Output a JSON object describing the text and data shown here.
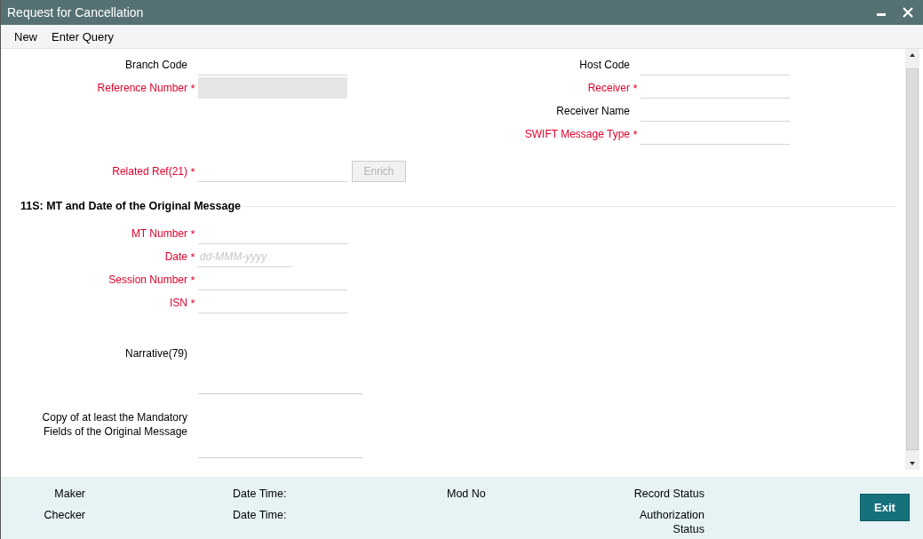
{
  "window": {
    "title": "Request for Cancellation"
  },
  "toolbar": [
    {
      "label": "New"
    },
    {
      "label": "Enter Query"
    }
  ],
  "header_left": [
    {
      "label": "Branch Code",
      "disabled": false
    },
    {
      "label": "Reference Number",
      "required_mark": "*",
      "disabled": true
    }
  ],
  "header_right": [
    {
      "label": "Host Code"
    },
    {
      "label": "Receiver",
      "required_mark": "*"
    },
    {
      "label": "Receiver Name"
    },
    {
      "label": "SWIFT Message Type",
      "required_mark": "*"
    }
  ],
  "related_ref": {
    "label": "Related Ref(21)",
    "required_mark": "*"
  },
  "enrich_button": {
    "label": "Enrich",
    "disabled": true
  },
  "section": {
    "title": "11S: MT and Date of the Original Message"
  },
  "message_fields": [
    {
      "label": "MT Number",
      "required_mark": "*",
      "kind": "text"
    },
    {
      "label": "Date",
      "required_mark": "*",
      "kind": "date",
      "placeholder": "dd-MMM-yyyy"
    },
    {
      "label": "Session Number",
      "required_mark": "*",
      "kind": "text"
    },
    {
      "label": "ISN",
      "required_mark": "*",
      "kind": "text"
    }
  ],
  "text_areas": [
    {
      "label": "Narrative(79)"
    },
    {
      "label": "Copy of at least the Mandatory Fields of the Original Message"
    }
  ],
  "footer": {
    "columns": [
      [
        "Maker",
        "Checker"
      ],
      [
        "Date Time:",
        "Date Time:"
      ],
      [
        "Mod No"
      ],
      [
        "Record Status",
        "Authorization Status"
      ]
    ]
  },
  "exit_button": {
    "label": "Exit"
  }
}
